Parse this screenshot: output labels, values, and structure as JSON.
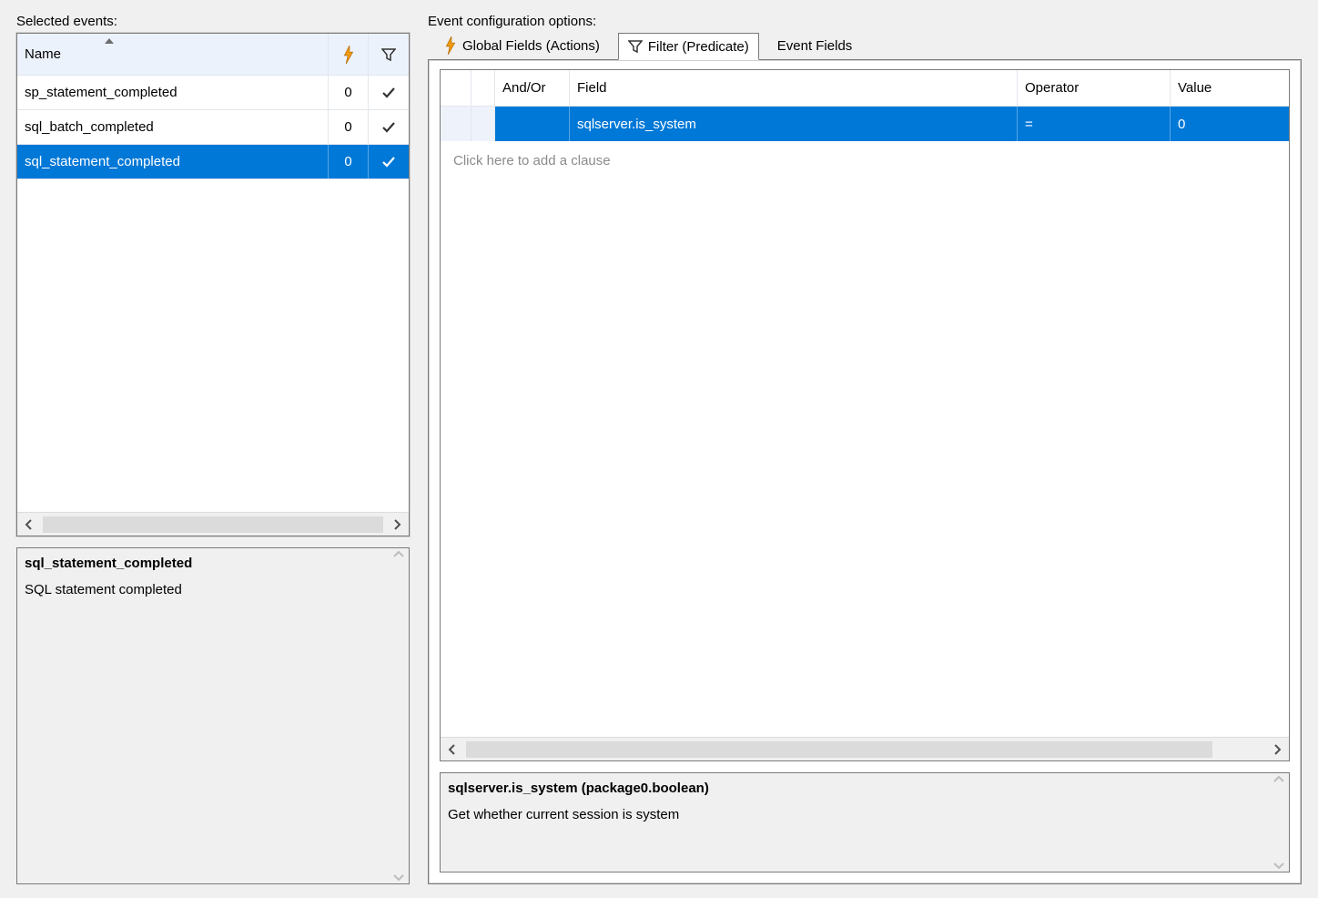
{
  "left": {
    "title": "Selected events:",
    "columns": {
      "name": "Name"
    },
    "events": [
      {
        "name": "sp_statement_completed",
        "count": "0",
        "filtered": true,
        "selected": false
      },
      {
        "name": "sql_batch_completed",
        "count": "0",
        "filtered": true,
        "selected": false
      },
      {
        "name": "sql_statement_completed",
        "count": "0",
        "filtered": true,
        "selected": true
      }
    ],
    "desc_title": "sql_statement_completed",
    "desc_body": "SQL statement completed"
  },
  "right": {
    "title": "Event configuration options:",
    "tabs": {
      "global_fields": "Global Fields (Actions)",
      "filter": "Filter (Predicate)",
      "event_fields": "Event Fields"
    },
    "pred_columns": {
      "andor": "And/Or",
      "field": "Field",
      "operator": "Operator",
      "value": "Value"
    },
    "pred_rows": [
      {
        "andor": "",
        "field": "sqlserver.is_system",
        "operator": "=",
        "value": "0"
      }
    ],
    "add_clause_hint": "Click here to add a clause",
    "desc_title": "sqlserver.is_system (package0.boolean)",
    "desc_body": "Get whether current session is system"
  }
}
